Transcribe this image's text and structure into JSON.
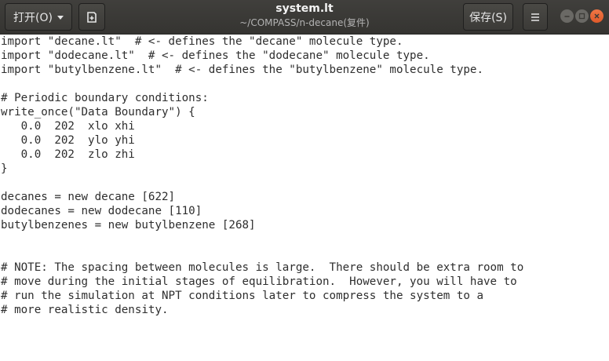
{
  "header": {
    "open_label": "打开(O)",
    "save_label": "保存(S)",
    "title": "system.lt",
    "subtitle": "~/COMPASS/n-decane(复件)",
    "icons": {
      "open_dropdown": "chevron-down-icon",
      "new_document": "new-document-icon",
      "menu": "hamburger-menu-icon",
      "minimize": "minimize-icon",
      "maximize": "maximize-icon",
      "close": "close-icon"
    },
    "colors": {
      "headerbar": "#3c3b37",
      "close_button": "#e95420"
    }
  },
  "editor": {
    "lines": [
      "import \"decane.lt\"  # <- defines the \"decane\" molecule type.",
      "import \"dodecane.lt\"  # <- defines the \"dodecane\" molecule type.",
      "import \"butylbenzene.lt\"  # <- defines the \"butylbenzene\" molecule type.",
      "",
      "# Periodic boundary conditions:",
      "write_once(\"Data Boundary\") {",
      "   0.0  202  xlo xhi",
      "   0.0  202  ylo yhi",
      "   0.0  202  zlo zhi",
      "}",
      "",
      "decanes = new decane [622]",
      "dodecanes = new dodecane [110]",
      "butylbenzenes = new butylbenzene [268]",
      "",
      "",
      "# NOTE: The spacing between molecules is large.  There should be extra room to",
      "# move during the initial stages of equilibration.  However, you will have to",
      "# run the simulation at NPT conditions later to compress the system to a",
      "# more realistic density."
    ]
  }
}
